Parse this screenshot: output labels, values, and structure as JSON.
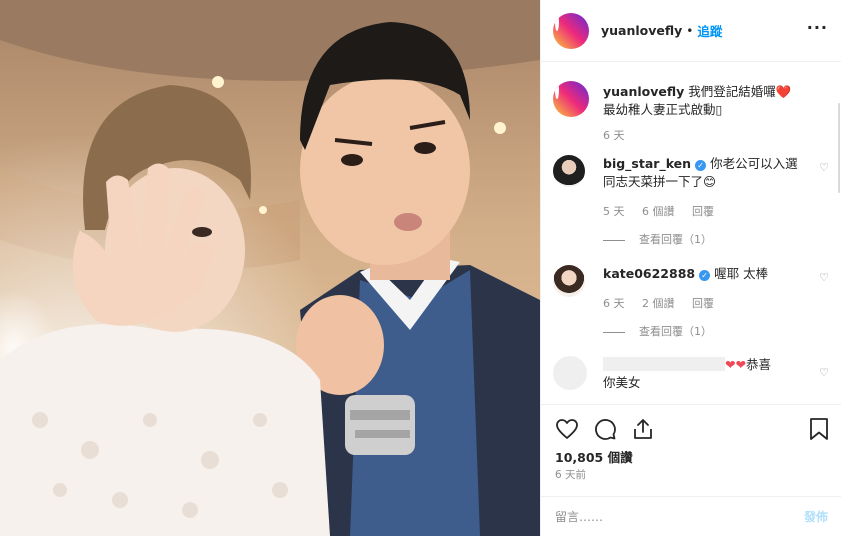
{
  "post": {
    "username": "yuanlovefly",
    "separator": "•",
    "follow_label": "追蹤",
    "more_icon": "more-options-icon"
  },
  "caption": {
    "username": "yuanlovefly",
    "text_line1": "我們登記結婚囉",
    "heart": "❤️",
    "text_line2": "最幼稚人妻正式啟動",
    "tail_glyph": "▯",
    "time": "6 天"
  },
  "comments": [
    {
      "username": "big_star_ken",
      "verified": true,
      "text_line1": "你老公可以入選",
      "text_line2": "同志天菜拼一下了",
      "emoji": "😊",
      "time": "5 天",
      "likes": "6 個讚",
      "reply_label": "回覆",
      "view_replies": "查看回覆（1）"
    },
    {
      "username": "kate0622888",
      "verified": true,
      "text": "喔耶 太棒",
      "time": "6 天",
      "likes": "2 個讚",
      "reply_label": "回覆",
      "view_replies": "查看回覆（1）"
    },
    {
      "username": "",
      "hearts": "❤❤",
      "text_line1": "恭喜",
      "text_line2": "你美女"
    }
  ],
  "actions": {
    "likes": "10,805 個讚",
    "date": "6 天前"
  },
  "add_comment": {
    "placeholder": "留言……",
    "post_label": "發佈"
  },
  "colors": {
    "accent": "#0095f6",
    "muted": "#8e8e8e",
    "heart": "#ed4956",
    "post_disabled": "#b2dffc"
  }
}
